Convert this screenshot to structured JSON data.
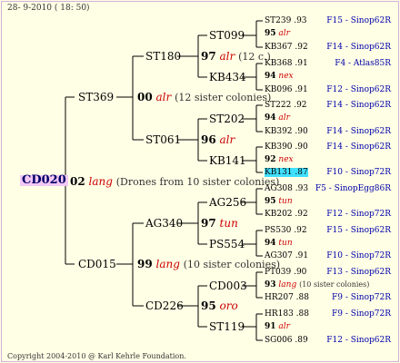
{
  "header": {
    "date_line": "28- 9-2010 ( 18: 50)"
  },
  "footer": {
    "copyright": "Copyright 2004-2010 @ Karl Kehrle Foundation."
  },
  "root": {
    "label": "CD020"
  },
  "gen1": [
    {
      "num": "00",
      "race": "alr",
      "note": "(12 sister colonies)",
      "parent": "ST369"
    },
    {
      "num": "02",
      "race": "lang",
      "note": "(Drones from 10 sister colonies)",
      "parent": ""
    },
    {
      "num": "99",
      "race": "lang",
      "note": "(10 sister colonies)",
      "parent": "CD015"
    }
  ],
  "gen2": [
    {
      "name": "ST180",
      "num": "97",
      "race": "alr",
      "note": "(12 c.)"
    },
    {
      "name": "ST061",
      "num": "96",
      "race": "alr",
      "note": ""
    },
    {
      "name": "AG340",
      "num": "97",
      "race": "tun",
      "note": ""
    },
    {
      "name": "CD226",
      "num": "95",
      "race": "oro",
      "note": ""
    }
  ],
  "gen3": [
    "ST099",
    "KB434",
    "ST202",
    "KB141",
    "AG256",
    "PS554",
    "CD003",
    "ST119"
  ],
  "gen4": [
    {
      "a": "ST239 .93",
      "num": "95",
      "race": "alr",
      "b": "KB367 .92",
      "ra": "F15 - Sinop62R",
      "rb": "F14 - Sinop62R"
    },
    {
      "a": "KB368 .91",
      "num": "94",
      "race": "nex",
      "b": "KB096 .91",
      "ra": "F4 - Atlas85R",
      "rb": "F12 - Sinop62R"
    },
    {
      "a": "ST222 .92",
      "num": "94",
      "race": "alr",
      "b": "KB392 .90",
      "ra": "F14 - Sinop62R",
      "rb": "F14 - Sinop62R"
    },
    {
      "a": "KB390 .90",
      "num": "92",
      "race": "nex",
      "b": "KB131 .87",
      "ra": "F14 - Sinop62R",
      "rb": "F10 - Sinop72R"
    },
    {
      "a": "AG308 .93",
      "num": "95",
      "race": "tun",
      "b": "KB202 .92",
      "ra": "F5 - SinopEgg86R",
      "rb": "F12 - Sinop72R"
    },
    {
      "a": "PS530 .92",
      "num": "94",
      "race": "tun",
      "b": "AG307 .91",
      "ra": "F15 - Sinop62R",
      "rb": "F10 - Sinop72R"
    },
    {
      "a": "PT039 .90",
      "num": "93",
      "race": "lang",
      "note": "(10 sister colonies)",
      "b": "HR207 .88",
      "ra": "F13 - Sinop62R",
      "rb": "F9 - Sinop72R"
    },
    {
      "a": "HR183 .88",
      "num": "91",
      "race": "alr",
      "b": "SG006 .89",
      "ra": "F9 - Sinop72R",
      "rb": "F12 - Sinop62R"
    }
  ]
}
